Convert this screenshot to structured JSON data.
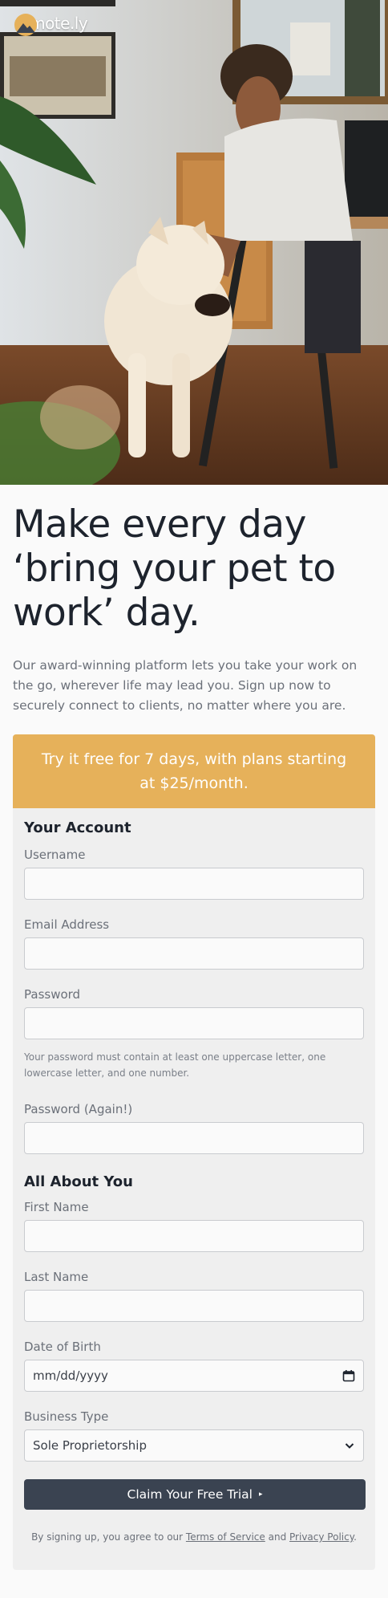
{
  "brand": {
    "name": "remote.ly",
    "accent": "#e6b15a",
    "dark": "#3a4351"
  },
  "hero": {
    "image": "man-with-dog-at-desk-photo"
  },
  "headline": "Make every day ‘bring your pet to work’ day.",
  "intro": "Our award-winning platform lets you take your work on the go, wherever life may lead you. Sign up now to securely connect to clients, no matter where you are.",
  "promo": "Try it free for 7 days, with plans starting at $25/month.",
  "form": {
    "account_title": "Your Account",
    "username_label": "Username",
    "email_label": "Email Address",
    "password_label": "Password",
    "password_hint": "Your password must contain at least one uppercase letter, one lowercase letter, and one number.",
    "password_again_label": "Password (Again!)",
    "about_title": "All About You",
    "first_name_label": "First Name",
    "last_name_label": "Last Name",
    "dob_label": "Date of Birth",
    "dob_placeholder": "mm/dd/yyyy",
    "business_label": "Business Type",
    "business_value": "Sole Proprietorship",
    "submit_label": "Claim Your Free Trial",
    "submit_arrow": "▸"
  },
  "legal": {
    "prefix": "By signing up, you agree to our",
    "terms": "Terms of Service",
    "and": "and",
    "privacy": "Privacy Policy",
    "suffix": "."
  }
}
